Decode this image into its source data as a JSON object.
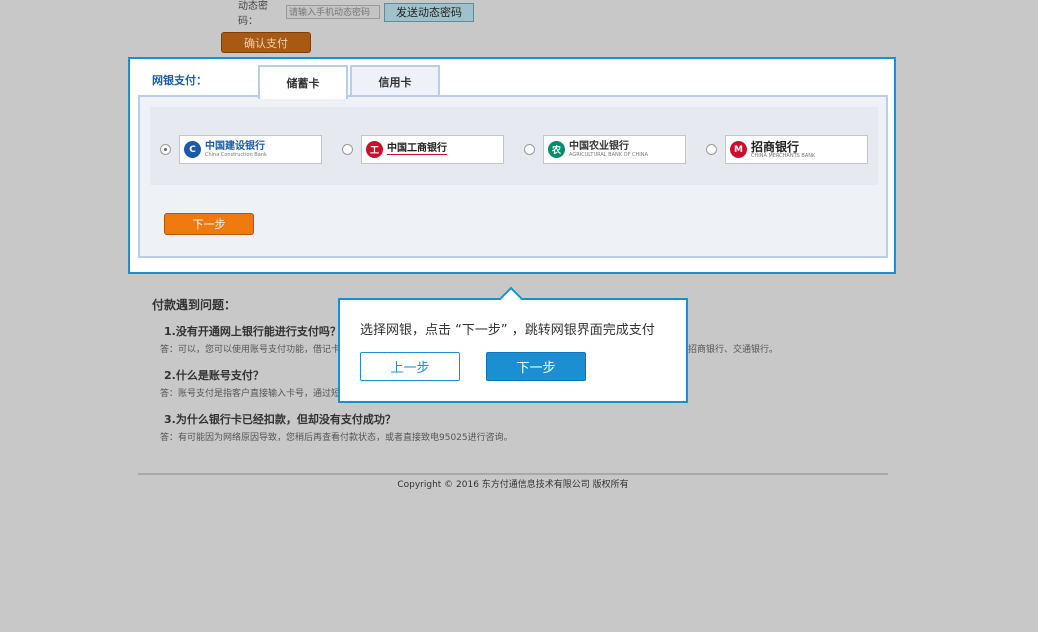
{
  "top": {
    "otp_label": "动态密码：",
    "otp_placeholder": "请输入手机动态密码",
    "send_otp_label": "发送动态密码",
    "confirm_label": "确认支付"
  },
  "panel": {
    "title": "网银支付：",
    "tabs": [
      {
        "label": "储蓄卡",
        "active": true
      },
      {
        "label": "信用卡",
        "active": false
      }
    ],
    "banks": [
      {
        "name_cn": "中国建设银行",
        "name_en": "China Construction Bank",
        "logo_color": "#1a5aa6",
        "logo_icon": "ccb-logo-icon",
        "selected": true
      },
      {
        "name_cn": "中国工商银行",
        "name_en": "",
        "logo_color": "#c8102e",
        "logo_icon": "icbc-logo-icon",
        "selected": false
      },
      {
        "name_cn": "中国农业银行",
        "name_en": "AGRICULTURAL BANK OF CHINA",
        "logo_color": "#0a8a6d",
        "logo_icon": "abc-logo-icon",
        "selected": false
      },
      {
        "name_cn": "招商银行",
        "name_en": "CHINA MERCHANTS BANK",
        "logo_color": "#c8102e",
        "logo_icon": "cmb-logo-icon",
        "selected": false
      }
    ],
    "next_label": "下一步"
  },
  "faq": {
    "title": "付款遇到问题：",
    "items": [
      {
        "q": "1.没有开通网上银行能进行支付吗？",
        "a": "答：可以，您可以使用账号支付功能，借记卡",
        "a_tail": "招商银行、交通银行。"
      },
      {
        "q": "2.什么是账号支付？",
        "a": "答：账号支付是指客户直接输入卡号，通过短"
      },
      {
        "q": "3.为什么银行卡已经扣款，但却没有支付成功？",
        "a": "答：有可能因为网络原因导致，您稍后再查看付款状态，或者直接致电95025进行咨询。"
      }
    ]
  },
  "footer": {
    "text": "Copyright © 2016 东方付通信息技术有限公司 版权所有"
  },
  "tooltip": {
    "text": "选择网银，点击 “下一步” ，跳转网银界面完成支付",
    "prev_label": "上一步",
    "next_label": "下一步"
  },
  "colors": {
    "accent": "#1c8fd3",
    "orange": "#ee7a10",
    "overlay": "#c8c8c8"
  }
}
